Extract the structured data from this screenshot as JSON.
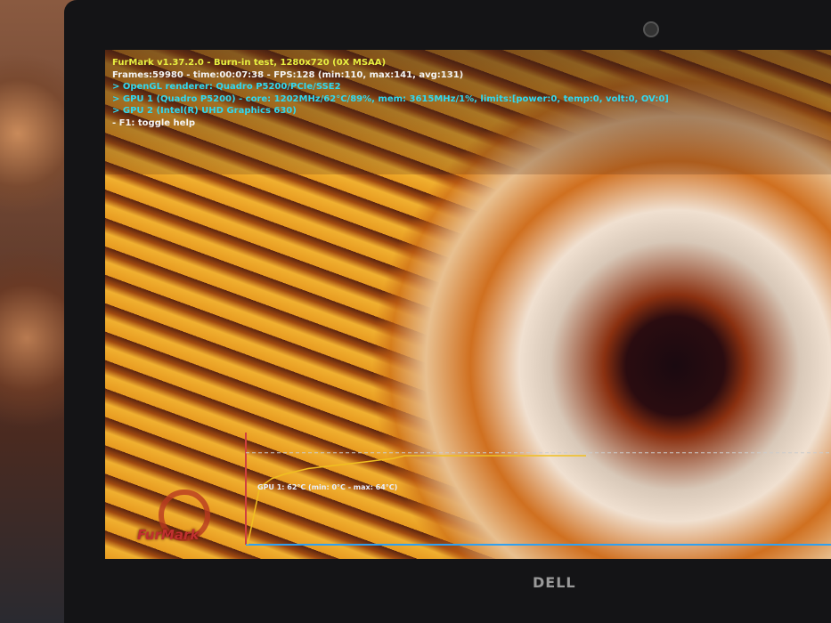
{
  "hud": {
    "title": "FurMark v1.37.2.0 - Burn-in test, 1280x720 (0X MSAA)",
    "stats": "Frames:59980 - time:00:07:38 - FPS:128 (min:110, max:141, avg:131)",
    "renderer": "> OpenGL renderer: Quadro P5200/PCIe/SSE2",
    "gpu1": "> GPU 1 (Quadro P5200) - core: 1202MHz/62°C/89%, mem: 3615MHz/1%, limits:[power:0, temp:0, volt:0, OV:0]",
    "gpu2": "> GPU 2 (Intel(R) UHD Graphics 630)",
    "help": "- F1: toggle help"
  },
  "graph": {
    "label": "GPU 1: 62°C (min: 0°C - max: 64°C)",
    "temps_c": [
      0,
      40,
      46,
      49,
      51,
      53,
      54,
      55,
      56,
      57,
      58,
      59,
      60,
      62,
      62,
      62,
      62,
      62,
      62,
      62,
      62,
      62,
      62,
      62,
      62,
      62,
      62,
      62,
      62
    ],
    "line_color": "#f0c020",
    "axis_color": "#30a0f0"
  },
  "logo": "FurMark",
  "brand": "DELL"
}
